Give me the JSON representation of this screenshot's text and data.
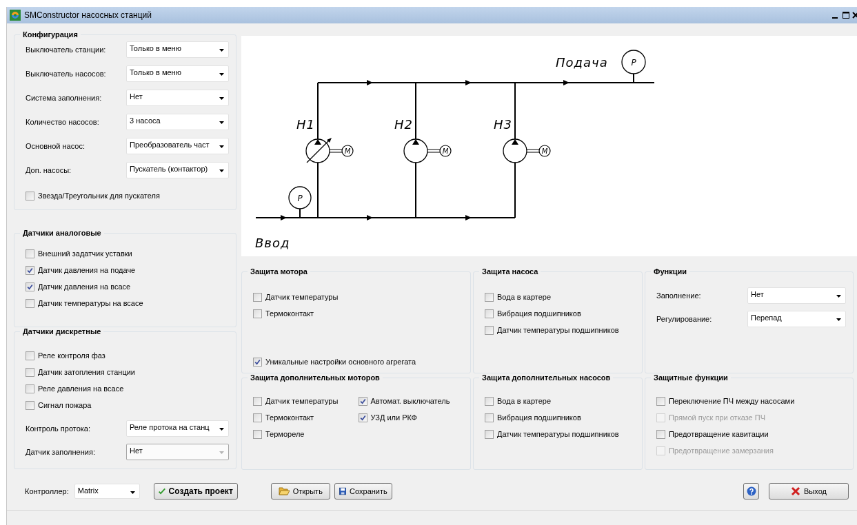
{
  "window": {
    "title": "SMConstructor насосных станций"
  },
  "configuration": {
    "title": "Конфигурация",
    "fields": [
      {
        "label": "Выключатель станции:",
        "value": "Только в меню",
        "disabled": false
      },
      {
        "label": "Выключатель насосов:",
        "value": "Только в меню",
        "disabled": false
      },
      {
        "label": "Система заполнения:",
        "value": "Нет",
        "disabled": false
      },
      {
        "label": "Количество насосов:",
        "value": "3 насоса",
        "disabled": false
      },
      {
        "label": "Основной насос:",
        "value": "Преобразователь част",
        "disabled": false
      },
      {
        "label": "Доп. насосы:",
        "value": "Пускатель (контактор)",
        "disabled": false
      }
    ],
    "checkboxes": [
      {
        "label": "Звезда/Треугольник для пускателя",
        "checked": false
      }
    ]
  },
  "analog_sensors": {
    "title": "Датчики аналоговые",
    "checkboxes": [
      {
        "label": "Внешний задатчик уставки",
        "checked": false
      },
      {
        "label": "Датчик давления на подаче",
        "checked": true
      },
      {
        "label": "Датчик давления на всасе",
        "checked": true
      },
      {
        "label": "Датчик температуры на всасе",
        "checked": false
      }
    ]
  },
  "discrete_sensors": {
    "title": "Датчики дискретные",
    "checkboxes": [
      {
        "label": "Реле контроля фаз",
        "checked": false
      },
      {
        "label": "Датчик затопления станции",
        "checked": false
      },
      {
        "label": "Реле давления на всасе",
        "checked": false
      },
      {
        "label": "Сигнал пожара",
        "checked": false
      }
    ],
    "fields": [
      {
        "label": "Контроль протока:",
        "value": "Реле протока на станц",
        "disabled": false
      },
      {
        "label": "Датчик заполнения:",
        "value": "Нет",
        "disabled": true
      }
    ]
  },
  "diagram": {
    "supply_label": "Подача",
    "intake_label": "Ввод",
    "supply_gauge": "P",
    "intake_gauge": "P",
    "pumps": [
      {
        "label": "Н1",
        "motor_label": "M",
        "variable": true
      },
      {
        "label": "Н2",
        "motor_label": "M",
        "variable": false
      },
      {
        "label": "Н3",
        "motor_label": "M",
        "variable": false
      }
    ]
  },
  "motor_protection": {
    "title": "Защита мотора",
    "checkboxes": [
      {
        "label": "Датчик температуры",
        "checked": false
      },
      {
        "label": "Термоконтакт",
        "checked": false
      }
    ],
    "unique_settings": {
      "label": "Уникальные настройки основного агрегата",
      "checked": true
    }
  },
  "extra_motor_protection": {
    "title": "Защита дополнительных моторов",
    "columns": [
      [
        {
          "label": "Датчик температуры",
          "checked": false
        },
        {
          "label": "Термоконтакт",
          "checked": false
        },
        {
          "label": "Термореле",
          "checked": false
        }
      ],
      [
        {
          "label": "Автомат. выключатель",
          "checked": true
        },
        {
          "label": "УЗД или РКФ",
          "checked": true
        }
      ]
    ]
  },
  "pump_protection": {
    "title": "Защита насоса",
    "checkboxes": [
      {
        "label": "Вода в картере",
        "checked": false
      },
      {
        "label": "Вибрация подшипников",
        "checked": false
      },
      {
        "label": "Датчик температуры подшипников",
        "checked": false
      }
    ]
  },
  "extra_pump_protection": {
    "title": "Защита дополнительных насосов",
    "checkboxes": [
      {
        "label": "Вода в картере",
        "checked": false
      },
      {
        "label": "Вибрация подшипников",
        "checked": false
      },
      {
        "label": "Датчик температуры подшипников",
        "checked": false
      }
    ]
  },
  "functions": {
    "title": "Функции",
    "fields": [
      {
        "label": "Заполнение:",
        "value": "Нет",
        "disabled": false
      },
      {
        "label": "Регулирование:",
        "value": "Перепад",
        "disabled": false
      }
    ]
  },
  "protective_functions": {
    "title": "Защитные функции",
    "checkboxes": [
      {
        "label": "Переключение ПЧ между насосами",
        "checked": false,
        "disabled": false
      },
      {
        "label": "Прямой пуск при отказе ПЧ",
        "checked": false,
        "disabled": true
      },
      {
        "label": "Предотвращение кавитации",
        "checked": false,
        "disabled": false
      },
      {
        "label": "Предотвращение замерзания",
        "checked": false,
        "disabled": true
      }
    ]
  },
  "bottom_bar": {
    "controller": {
      "label": "Контроллер:",
      "value": "Matrix",
      "disabled": false
    },
    "buttons": [
      {
        "kind": "create",
        "label": "Создать проект"
      },
      {
        "kind": "open",
        "label": "Открыть"
      },
      {
        "kind": "save",
        "label": "Сохранить"
      },
      {
        "kind": "help"
      },
      {
        "kind": "exit",
        "label": "Выход"
      }
    ]
  }
}
